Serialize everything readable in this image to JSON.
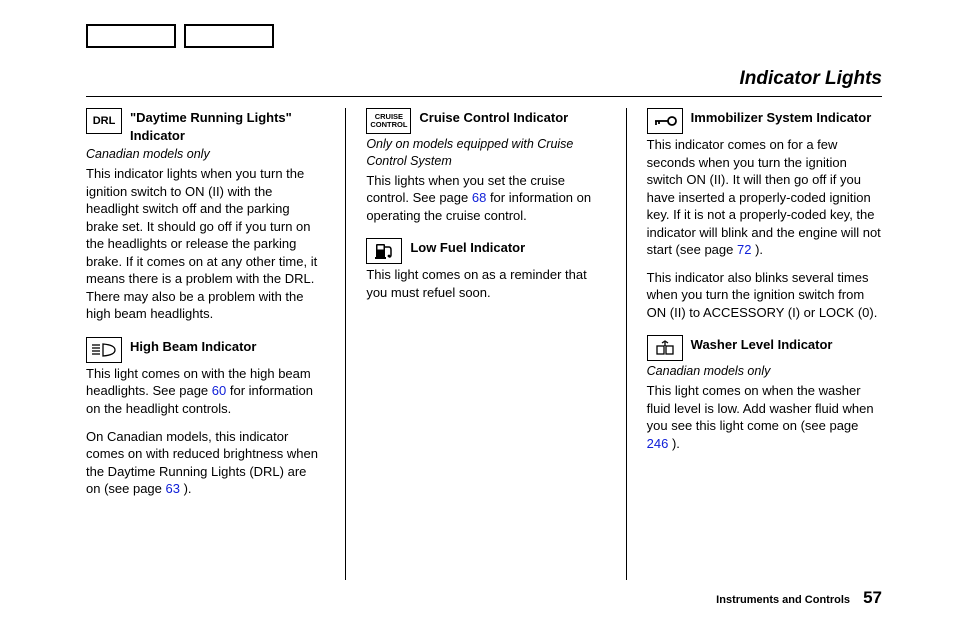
{
  "page_title": "Indicator Lights",
  "footer": {
    "section": "Instruments and Controls",
    "page": "57"
  },
  "col1": {
    "e1": {
      "icon": "DRL",
      "title": "\"Daytime Running Lights\" Indicator",
      "note": "Canadian models only",
      "body": "This indicator lights when you turn the ignition switch to ON (II) with the headlight switch off and the parking brake set. It should go off if you turn on the headlights or release the parking brake. If it comes on at any other time, it means there is a problem with the DRL. There may also be a problem with the high beam headlights."
    },
    "e2": {
      "title": "High Beam Indicator",
      "body_a": "This light comes on with the high beam headlights. See page ",
      "link_a": "60",
      "body_b": " for information on the headlight controls.",
      "body_c": "On Canadian models, this indicator comes on with reduced brightness when the Daytime Running Lights (DRL) are on (see page ",
      "link_c": "63",
      "body_d": " )."
    }
  },
  "col2": {
    "e1": {
      "icon_l1": "CRUISE",
      "icon_l2": "CONTROL",
      "title": "Cruise Control Indicator",
      "note": "Only on models equipped with Cruise Control System",
      "body_a": "This lights when you set the cruise control. See page ",
      "link_a": "68",
      "body_b": " for information on operating the cruise control."
    },
    "e2": {
      "title": "Low Fuel Indicator",
      "body": "This light comes on as a reminder that you must refuel soon."
    }
  },
  "col3": {
    "e1": {
      "title": "Immobilizer System Indicator",
      "body_a": "This indicator comes on for a few seconds when you turn the ignition switch ON (II). It will then go off if you have inserted a properly-coded ignition key. If it is not a properly-coded key, the indicator will blink and the engine will not start (see page ",
      "link_a": "72",
      "body_b": " ).",
      "body_c": "This indicator also blinks several times when you turn the ignition switch from ON (II) to ACCESSORY (I) or LOCK (0)."
    },
    "e2": {
      "title": "Washer Level Indicator",
      "note": "Canadian models only",
      "body_a": "This light comes on when the washer fluid level is low. Add washer fluid when you see this light come on (see page ",
      "link_a": "246",
      "body_b": " )."
    }
  }
}
